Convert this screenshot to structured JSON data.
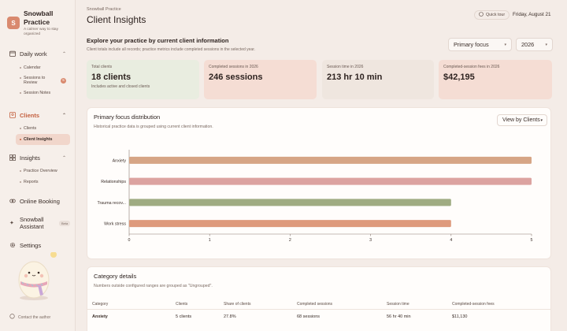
{
  "app": {
    "logo_letter": "S",
    "name": "Snowball Practice",
    "tagline": "A calmer way to stay organized"
  },
  "sidebar": {
    "daily_work": {
      "label": "Daily work",
      "items": [
        {
          "label": "Calendar"
        },
        {
          "label": "Sessions to Review",
          "badge": "5"
        },
        {
          "label": "Session Notes"
        }
      ]
    },
    "clients": {
      "label": "Clients",
      "items": [
        {
          "label": "Clients"
        },
        {
          "label": "Client Insights"
        }
      ]
    },
    "insights": {
      "label": "Insights",
      "items": [
        {
          "label": "Practice Overview"
        },
        {
          "label": "Reports"
        }
      ]
    },
    "online_booking": "Online Booking",
    "assistant": {
      "label": "Snowball Assistant",
      "badge": "Beta"
    },
    "settings": "Settings",
    "contact": "Contact the author"
  },
  "header": {
    "breadcrumb": "Snowball Practice",
    "title": "Client Insights",
    "quick_tour": "Quick tour",
    "date": "Friday, August 21"
  },
  "intro": {
    "title": "Explore your practice by current client information",
    "subtitle": "Client totals include all records; practice metrics include completed sessions in the selected year.",
    "focus_select": "Primary focus",
    "year_select": "2026"
  },
  "stats": [
    {
      "label": "Total clients",
      "value": "18 clients",
      "note": "Includes active and closed clients",
      "bg": "#e9ede0"
    },
    {
      "label": "Completed sessions in 2026",
      "value": "246 sessions",
      "note": "",
      "bg": "#f5ddd4"
    },
    {
      "label": "Session time in 2026",
      "value": "213 hr 10 min",
      "note": "",
      "bg": "#efe6df"
    },
    {
      "label": "Completed-session fees in 2026",
      "value": "$42,195",
      "note": "",
      "bg": "#f5ddd4"
    }
  ],
  "distribution": {
    "title": "Primary focus distribution",
    "subtitle": "Historical practice data is grouped using current client information.",
    "view_button": "View by Clients"
  },
  "chart_data": {
    "type": "bar",
    "orientation": "horizontal",
    "categories": [
      "Anxiety",
      "Relationships",
      "Trauma recov...",
      "Work stress"
    ],
    "values": [
      5,
      5,
      4,
      4
    ],
    "colors": [
      "#d6a585",
      "#dca3a0",
      "#9fac82",
      "#de9a7c"
    ],
    "xlim": [
      0,
      5
    ],
    "xticks": [
      "0",
      "1",
      "2",
      "3",
      "4",
      "5"
    ],
    "grid": false
  },
  "details": {
    "title": "Category details",
    "subtitle": "Numbers outside configured ranges are grouped as \"Ungrouped\".",
    "columns": [
      "Category",
      "Clients",
      "Share of clients",
      "Completed sessions",
      "Session time",
      "Completed-session fees"
    ],
    "rows": [
      [
        "Anxiety",
        "5 clients",
        "27.8%",
        "68 sessions",
        "56 hr 40 min",
        "$11,130"
      ]
    ]
  }
}
